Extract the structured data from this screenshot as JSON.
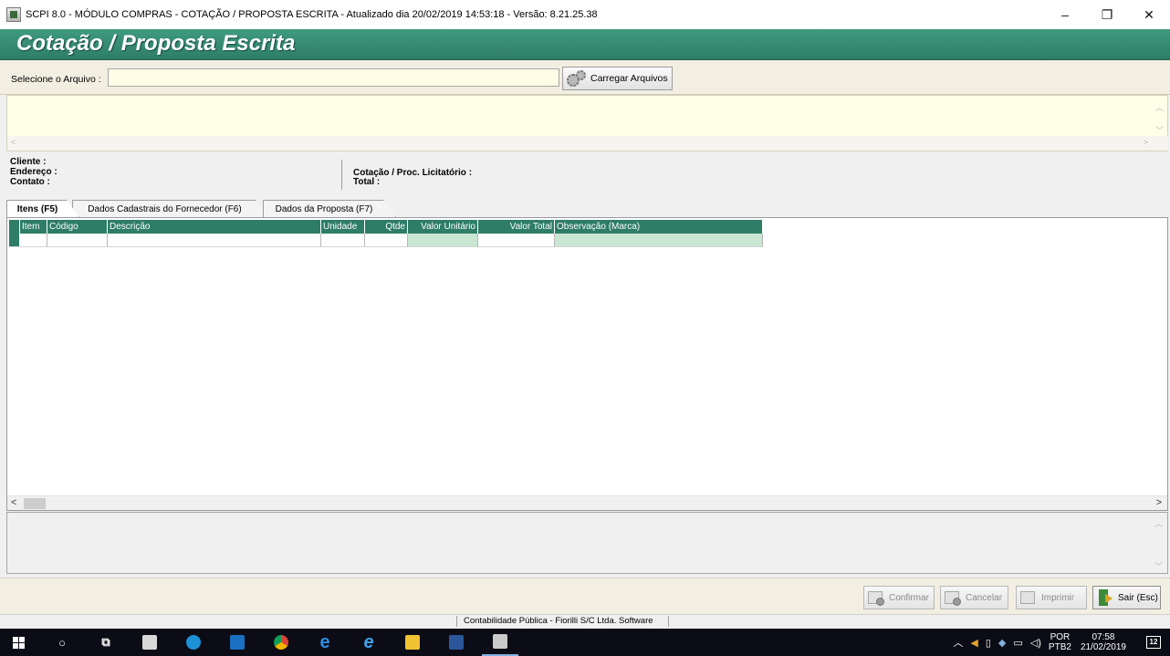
{
  "window": {
    "title": "SCPI 8.0 - MÓDULO COMPRAS - COTAÇÃO / PROPOSTA ESCRITA - Atualizado dia 20/02/2019 14:53:18 - Versão: 8.21.25.38",
    "minimize": "–",
    "maximize": "❐",
    "close": "✕"
  },
  "banner": {
    "title": "Cotação / Proposta Escrita"
  },
  "file_select": {
    "label": "Selecione o Arquivo :",
    "value": "",
    "button_label": "Carregar Arquivos"
  },
  "info": {
    "cliente_label": "Cliente :",
    "endereco_label": "Endereço :",
    "contato_label": "Contato :",
    "cotacao_label": "Cotação / Proc. Licitatório :",
    "total_label": "Total :"
  },
  "tabs": [
    {
      "label": "Itens (F5)",
      "active": true
    },
    {
      "label": "Dados Cadastrais do Fornecedor (F6)",
      "active": false
    },
    {
      "label": "Dados da Proposta (F7)",
      "active": false
    }
  ],
  "grid": {
    "columns": [
      "Item",
      "Código",
      "Descrição",
      "Unidade",
      "Qtde",
      "Valor Unitário",
      "Valor Total",
      "Observação (Marca)"
    ]
  },
  "actions": {
    "confirmar": "Confirmar",
    "cancelar": "Cancelar",
    "imprimir": "Imprimir",
    "sair": "Sair (Esc)"
  },
  "status_bar": {
    "text": "Contabilidade Pública - Fiorilli S/C Ltda. Software"
  },
  "taskbar": {
    "language": "POR",
    "layout": "PTB2",
    "time": "07:58",
    "date": "21/02/2019",
    "notifications": "12",
    "icons": [
      "windows-icon",
      "search-icon",
      "task-view-icon",
      "calculator-icon",
      "skype-icon",
      "outlook-icon",
      "chrome-icon",
      "edge-icon",
      "internet-explorer-icon",
      "file-explorer-icon",
      "word-icon",
      "scpi-icon"
    ]
  },
  "colors": {
    "accent": "#2e7d66",
    "panel_beige": "#f2efe2",
    "input_yellow": "#fffde6",
    "grid_green_cell": "#c9e6d3"
  }
}
